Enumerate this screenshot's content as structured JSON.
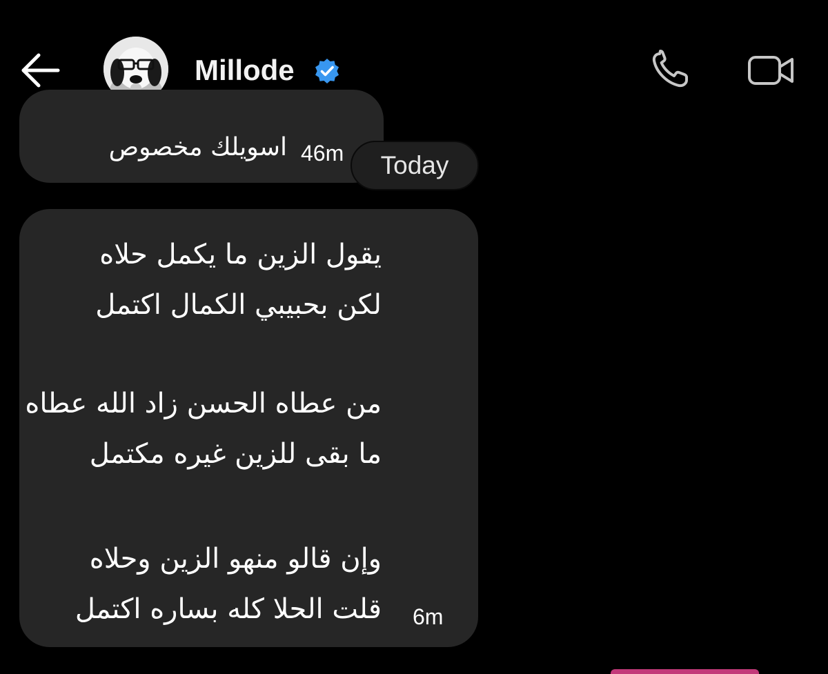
{
  "header": {
    "back_label": "back",
    "contact_name": "Millode",
    "verified": true,
    "accent_color": "#3897f0"
  },
  "messages": [
    {
      "text": "اسويلك مخصوص",
      "time": "46m"
    },
    {
      "lines": [
        "يقول الزين ما يكمل حلاه",
        "لكن بحبيبي الكمال اكتمل",
        "",
        "من عطاه الحسن زاد الله عطاه",
        "ما بقى للزين غيره مكتمل",
        "",
        "وإن قالو منهو الزين وحلاه",
        "قلت الحلا كله بساره اكتمل"
      ],
      "time": "6m"
    }
  ],
  "date_separator": "Today",
  "icons": {
    "back": "back-arrow-icon",
    "verified": "verified-badge-icon",
    "call": "phone-icon",
    "video": "video-camera-icon"
  },
  "colors": {
    "background": "#000000",
    "bubble": "#262626",
    "text": "#ffffff",
    "verified": "#3897f0"
  }
}
